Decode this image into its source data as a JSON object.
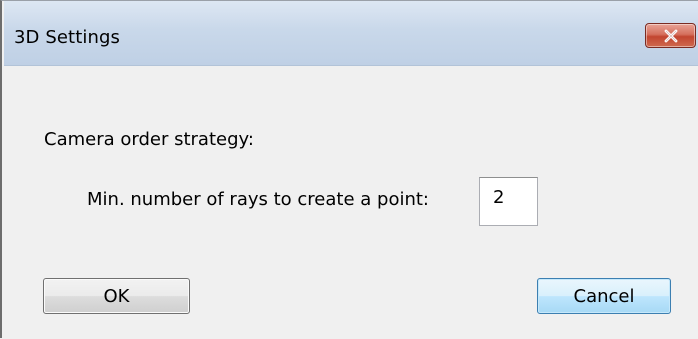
{
  "window": {
    "title": "3D Settings",
    "close_icon": "close-icon"
  },
  "form": {
    "camera_order_label": "Camera order strategy:",
    "min_rays_label": "Min. number of rays to create a point:",
    "min_rays_value": "2"
  },
  "buttons": {
    "ok_label": "OK",
    "cancel_label": "Cancel"
  },
  "colors": {
    "titlebar": "#c9d8ea",
    "close_button": "#c24530",
    "cancel_button_border": "#3c7fb1",
    "background": "#f0f0f0"
  }
}
